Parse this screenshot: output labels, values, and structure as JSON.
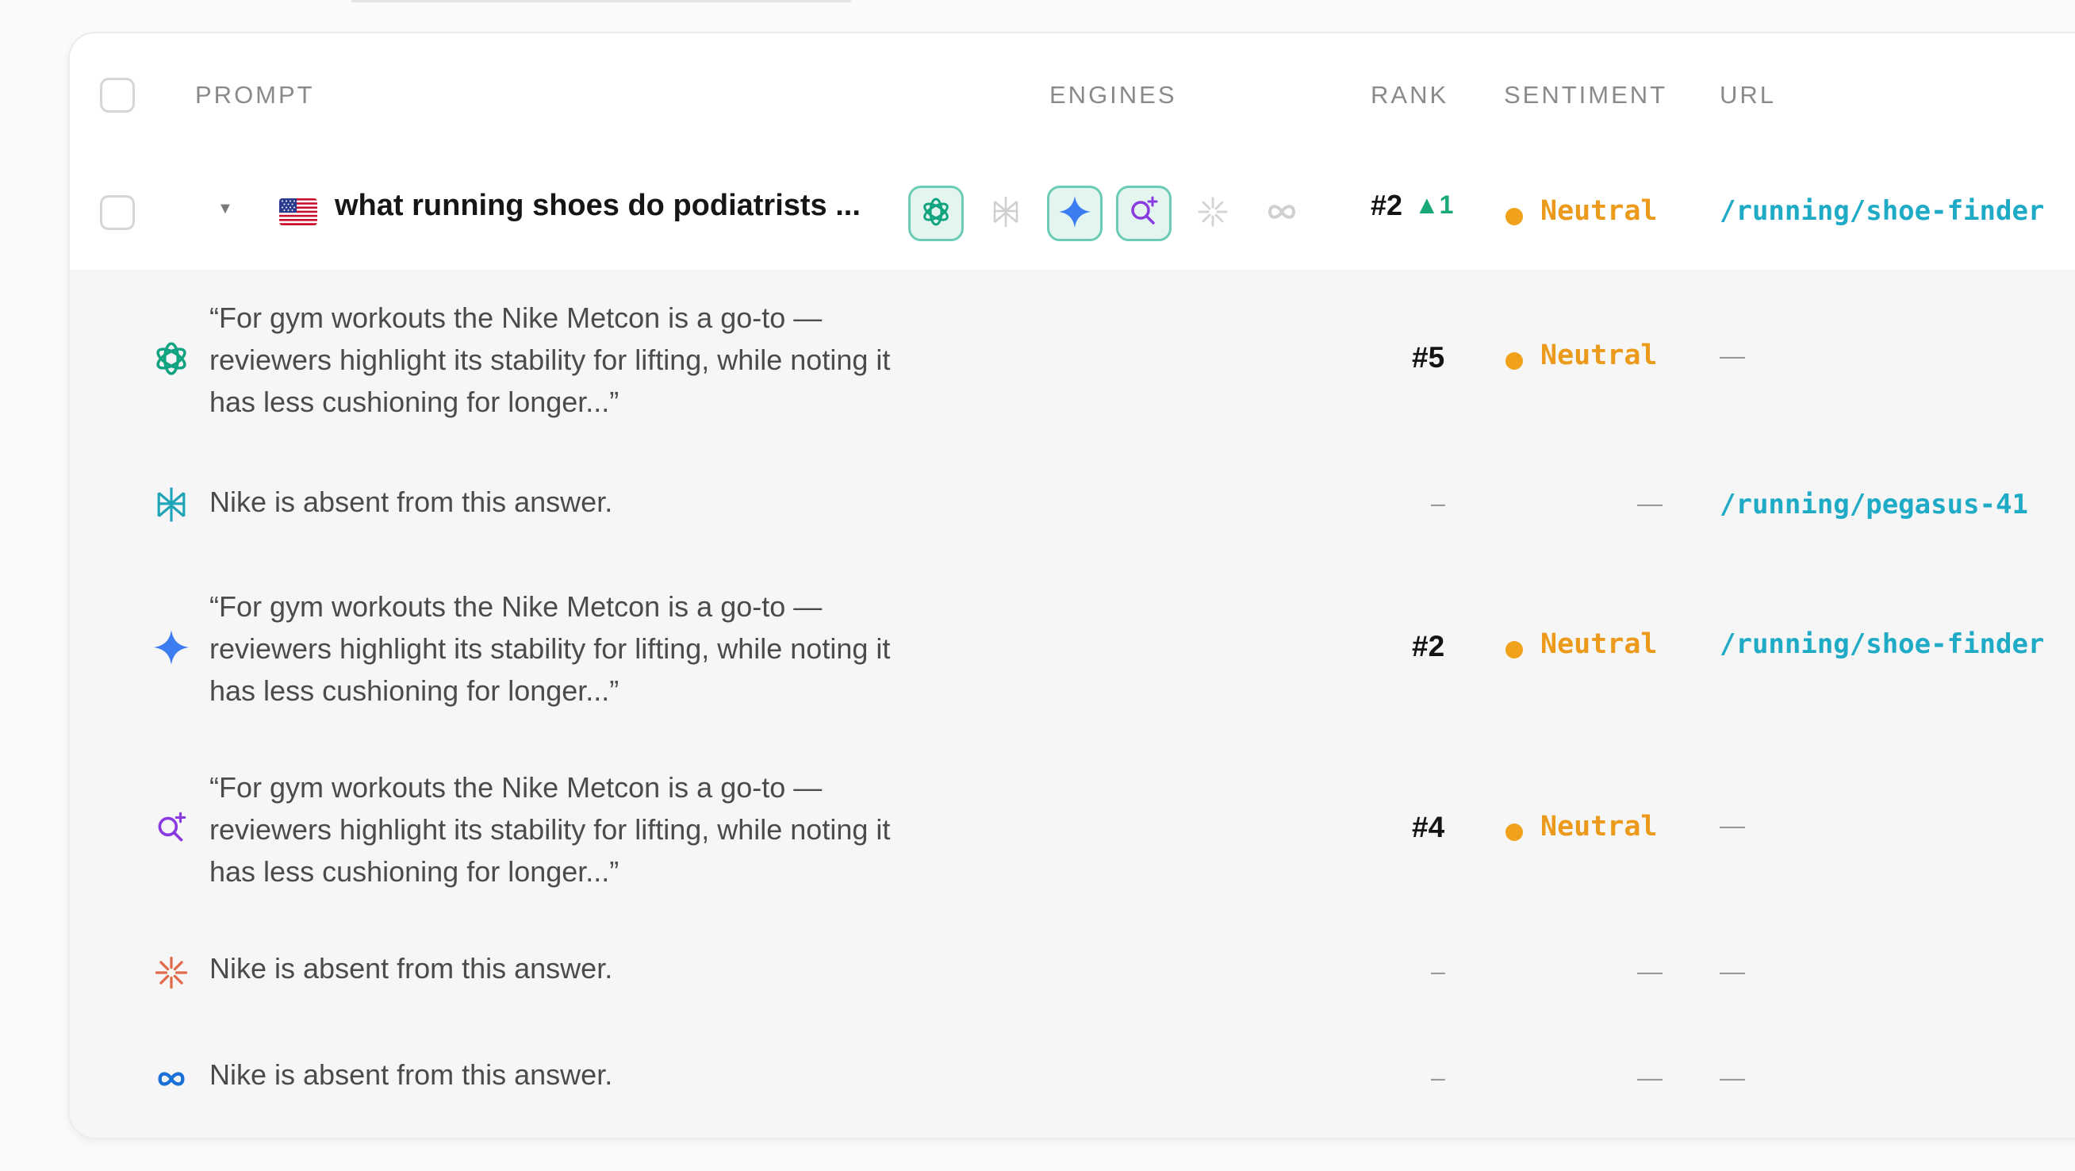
{
  "table": {
    "headers": {
      "prompt": "PROMPT",
      "engines": "ENGINES",
      "rank": "RANK",
      "sentiment": "SENTIMENT",
      "url": "URL"
    },
    "prompt_row": {
      "country_icon": "us-flag-icon",
      "text": "what running shoes do podiatrists ...",
      "engines": [
        {
          "icon": "chatgpt-icon",
          "selected": true
        },
        {
          "icon": "perplexity-icon",
          "selected": false
        },
        {
          "icon": "gemini-icon",
          "selected": true
        },
        {
          "icon": "ai-search-icon",
          "selected": true
        },
        {
          "icon": "claude-icon",
          "selected": false
        },
        {
          "icon": "meta-ai-icon",
          "selected": false
        }
      ],
      "rank": "#2",
      "rank_change": "▲1",
      "sentiment": "Neutral",
      "url": "/running/shoe-finder"
    },
    "responses": [
      {
        "engine_icon": "chatgpt-icon",
        "snippet": "“For gym workouts the Nike Metcon is a go-to — reviewers highlight its stability for lifting, while noting it has less cushioning for longer...”",
        "rank": "#5",
        "sentiment": "Neutral",
        "url": "—"
      },
      {
        "engine_icon": "perplexity-icon",
        "snippet": "Nike is absent from this answer.",
        "rank": "–",
        "sentiment": "—",
        "url": "/running/pegasus-41"
      },
      {
        "engine_icon": "gemini-icon",
        "snippet": "“For gym workouts the Nike Metcon is a go-to — reviewers highlight its stability for lifting, while noting it has less cushioning for longer...”",
        "rank": "#2",
        "sentiment": "Neutral",
        "url": "/running/shoe-finder"
      },
      {
        "engine_icon": "ai-search-icon",
        "snippet": "“For gym workouts the Nike Metcon is a go-to — reviewers highlight its stability for lifting, while noting it has less cushioning for longer...”",
        "rank": "#4",
        "sentiment": "Neutral",
        "url": "—"
      },
      {
        "engine_icon": "claude-icon",
        "snippet": "Nike is absent from this answer.",
        "rank": "–",
        "sentiment": "—",
        "url": "—"
      },
      {
        "engine_icon": "meta-ai-icon",
        "snippet": "Nike is absent from this answer.",
        "rank": "–",
        "sentiment": "—",
        "url": "—"
      }
    ]
  },
  "colors": {
    "sentiment_neutral": "#f0a21c",
    "url": "#1faac6",
    "rank_up": "#19a979",
    "engine_selected_border": "#6bcbb5"
  }
}
